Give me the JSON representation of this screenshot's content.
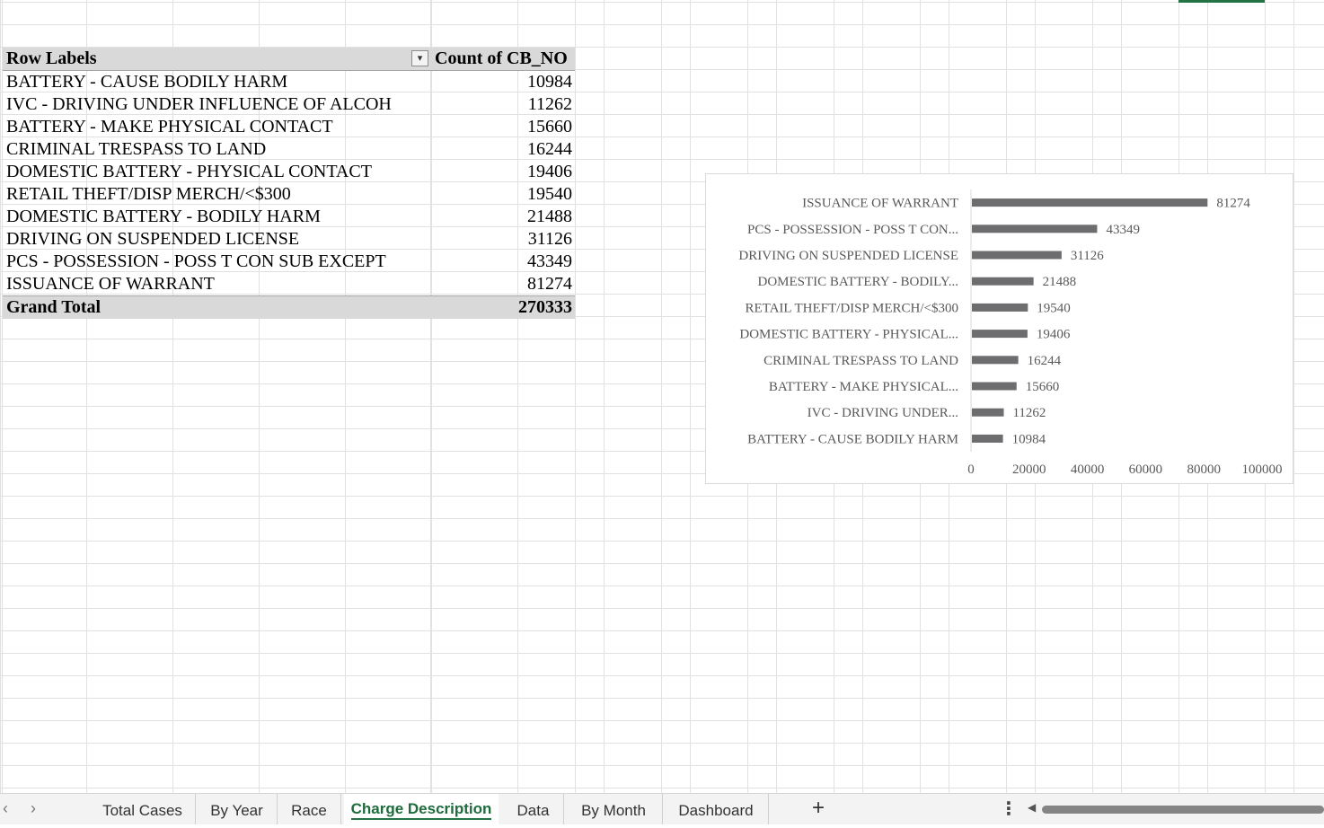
{
  "pivot": {
    "header_label": "Row Labels",
    "header_value": "Count of CB_NO",
    "rows": [
      {
        "label": "BATTERY - CAUSE BODILY HARM",
        "value": "10984"
      },
      {
        "label": "IVC - DRIVING UNDER INFLUENCE OF ALCOH",
        "value": "11262"
      },
      {
        "label": "BATTERY - MAKE PHYSICAL CONTACT",
        "value": "15660"
      },
      {
        "label": "CRIMINAL TRESPASS TO LAND",
        "value": "16244"
      },
      {
        "label": "DOMESTIC BATTERY - PHYSICAL CONTACT",
        "value": "19406"
      },
      {
        "label": "RETAIL THEFT/DISP MERCH/<$300",
        "value": "19540"
      },
      {
        "label": "DOMESTIC BATTERY - BODILY HARM",
        "value": "21488"
      },
      {
        "label": "DRIVING ON SUSPENDED LICENSE",
        "value": "31126"
      },
      {
        "label": "PCS - POSSESSION - POSS T CON SUB EXCEPT",
        "value": "43349"
      },
      {
        "label": "ISSUANCE OF WARRANT",
        "value": "81274"
      }
    ],
    "total_label": "Grand Total",
    "total_value": "270333"
  },
  "chart_data": {
    "type": "bar",
    "orientation": "horizontal",
    "categories": [
      "ISSUANCE OF WARRANT",
      "PCS - POSSESSION - POSS T CON...",
      "DRIVING ON SUSPENDED LICENSE",
      "DOMESTIC BATTERY - BODILY...",
      "RETAIL THEFT/DISP MERCH/<$300",
      "DOMESTIC BATTERY - PHYSICAL...",
      "CRIMINAL TRESPASS TO LAND",
      "BATTERY - MAKE PHYSICAL...",
      "IVC - DRIVING UNDER...",
      "BATTERY - CAUSE BODILY HARM"
    ],
    "values": [
      81274,
      43349,
      31126,
      21488,
      19540,
      19406,
      16244,
      15660,
      11262,
      10984
    ],
    "xlim": [
      0,
      100000
    ],
    "xticks": [
      "0",
      "20000",
      "40000",
      "60000",
      "80000",
      "100000"
    ],
    "bar_color": "#6d6d6f",
    "data_labels": true,
    "grid": false,
    "legend": "none",
    "title": "",
    "xlabel": "",
    "ylabel": ""
  },
  "tabs": {
    "items": [
      {
        "label": "Total Cases",
        "active": false
      },
      {
        "label": "By Year",
        "active": false
      },
      {
        "label": "Race",
        "active": false
      },
      {
        "label": "Charge Description",
        "active": true
      },
      {
        "label": "Data",
        "active": false
      },
      {
        "label": "By Month",
        "active": false
      },
      {
        "label": "Dashboard",
        "active": false
      }
    ],
    "add_label": "+",
    "more_label": "⋮",
    "nav_prev": "‹",
    "nav_next": "›"
  },
  "colors": {
    "grid": "#e1e1e1",
    "header_fill": "#d9d9d9",
    "accent": "#217346",
    "bar": "#6d6d6f"
  }
}
